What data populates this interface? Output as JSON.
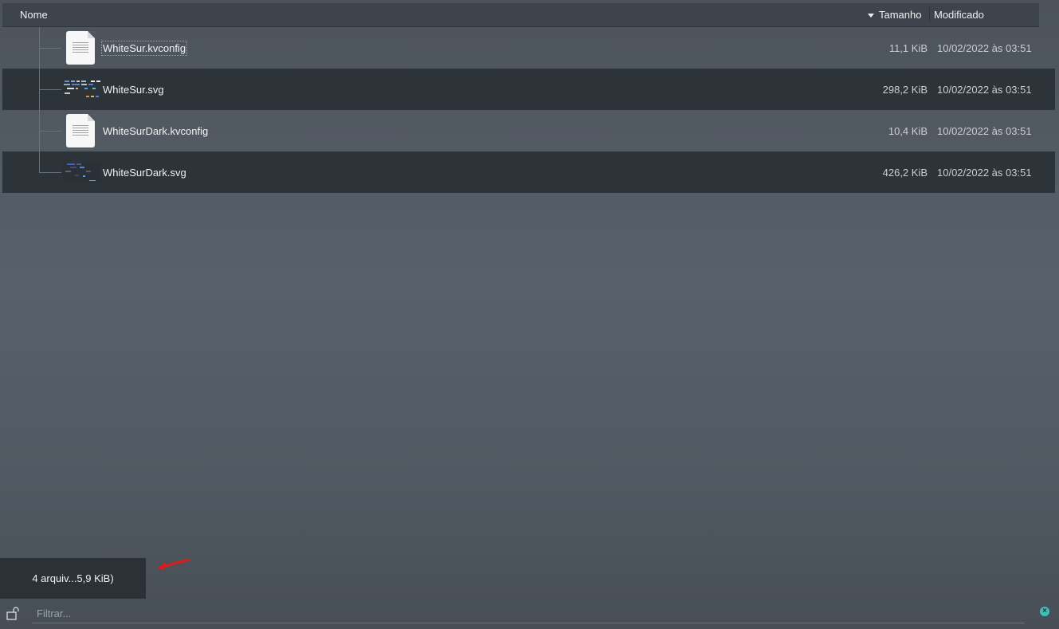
{
  "columns": {
    "name": "Nome",
    "size": "Tamanho",
    "modified": "Modificado"
  },
  "files": [
    {
      "name": "WhiteSur.kvconfig",
      "size": "11,1 KiB",
      "modified": "10/02/2022 às 03:51",
      "icon": "text-file-icon"
    },
    {
      "name": "WhiteSur.svg",
      "size": "298,2 KiB",
      "modified": "10/02/2022 às 03:51",
      "icon": "svg-thumbnail"
    },
    {
      "name": "WhiteSurDark.kvconfig",
      "size": "10,4 KiB",
      "modified": "10/02/2022 às 03:51",
      "icon": "text-file-icon"
    },
    {
      "name": "WhiteSurDark.svg",
      "size": "426,2 KiB",
      "modified": "10/02/2022 às 03:51",
      "icon": "svg-thumbnail"
    }
  ],
  "status": {
    "text": "4 arquiv...5,9 KiB)"
  },
  "filter": {
    "placeholder": "Filtrar...",
    "lock_icon": "unlock-icon",
    "clear_icon": "clear-icon"
  },
  "colors": {
    "accent": "#3ec2b3",
    "annotation_arrow": "#e01b1b"
  }
}
